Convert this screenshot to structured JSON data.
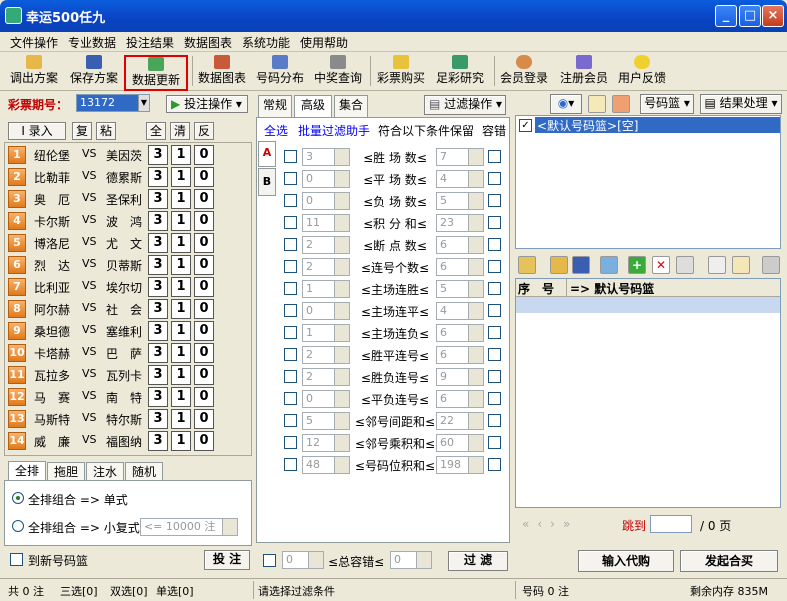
{
  "app": {
    "title": "幸运500任九"
  },
  "menu": [
    "文件操作",
    "专业数据",
    "投注结果",
    "数据图表",
    "系统功能",
    "使用帮助"
  ],
  "toolbar": [
    "调出方案",
    "保存方案",
    "数据更新",
    "数据图表",
    "号码分布",
    "中奖查询",
    "彩票购买",
    "足彩研究",
    "会员登录",
    "注册会员",
    "用户反馈"
  ],
  "period": {
    "label": "彩票期号：",
    "value": "13172"
  },
  "bet_op": "投注操作",
  "left_buttons": {
    "enter": "I 录入",
    "copy": "复",
    "paste": "粘",
    "all": "全",
    "clear": "清",
    "invert": "反"
  },
  "matches": [
    {
      "no": "1",
      "home": "纽伦堡",
      "vs": "VS",
      "away": "美因茨",
      "a": "3",
      "b": "1",
      "c": "0"
    },
    {
      "no": "2",
      "home": "比勒菲",
      "vs": "VS",
      "away": "德累斯",
      "a": "3",
      "b": "1",
      "c": "0"
    },
    {
      "no": "3",
      "home": "奥　厄",
      "vs": "VS",
      "away": "圣保利",
      "a": "3",
      "b": "1",
      "c": "0"
    },
    {
      "no": "4",
      "home": "卡尔斯",
      "vs": "VS",
      "away": "波　鸿",
      "a": "3",
      "b": "1",
      "c": "0"
    },
    {
      "no": "5",
      "home": "博洛尼",
      "vs": "VS",
      "away": "尤　文",
      "a": "3",
      "b": "1",
      "c": "0"
    },
    {
      "no": "6",
      "home": "烈　达",
      "vs": "VS",
      "away": "贝蒂斯",
      "a": "3",
      "b": "1",
      "c": "0"
    },
    {
      "no": "7",
      "home": "比利亚",
      "vs": "VS",
      "away": "埃尔切",
      "a": "3",
      "b": "1",
      "c": "0"
    },
    {
      "no": "8",
      "home": "阿尔赫",
      "vs": "VS",
      "away": "社　会",
      "a": "3",
      "b": "1",
      "c": "0"
    },
    {
      "no": "9",
      "home": "桑坦德",
      "vs": "VS",
      "away": "塞维利",
      "a": "3",
      "b": "1",
      "c": "0"
    },
    {
      "no": "10",
      "home": "卡塔赫",
      "vs": "VS",
      "away": "巴　萨",
      "a": "3",
      "b": "1",
      "c": "0"
    },
    {
      "no": "11",
      "home": "瓦拉多",
      "vs": "VS",
      "away": "瓦列卡",
      "a": "3",
      "b": "1",
      "c": "0"
    },
    {
      "no": "12",
      "home": "马　赛",
      "vs": "VS",
      "away": "南　特",
      "a": "3",
      "b": "1",
      "c": "0"
    },
    {
      "no": "13",
      "home": "马斯特",
      "vs": "VS",
      "away": "特尔斯",
      "a": "3",
      "b": "1",
      "c": "0"
    },
    {
      "no": "14",
      "home": "威　廉",
      "vs": "VS",
      "away": "福图纳",
      "a": "3",
      "b": "1",
      "c": "0"
    }
  ],
  "left_tabs": [
    "全排",
    "拖胆",
    "注水",
    "随机"
  ],
  "radio1": "全排组合 => 单式",
  "radio2": "全排组合 => 小复式",
  "combo_limit": "<= 10000 注",
  "to_new_basket": "到新号码篮",
  "bet_button": "投 注",
  "mid_tabs": [
    "常规",
    "高级",
    "集合"
  ],
  "filter_op": "过滤操作",
  "filter_bar": {
    "select_all": "全选",
    "batch": "批量过滤助手",
    "keep": "符合以下条件保留",
    "tolerance": "容错"
  },
  "side_tabs": [
    "A",
    "B"
  ],
  "filters": [
    {
      "min": "3",
      "label": "胜 场 数",
      "max": "7"
    },
    {
      "min": "0",
      "label": "平 场 数",
      "max": "4"
    },
    {
      "min": "0",
      "label": "负 场 数",
      "max": "5"
    },
    {
      "min": "11",
      "label": "积 分 和",
      "max": "23"
    },
    {
      "min": "2",
      "label": "断 点 数",
      "max": "6"
    },
    {
      "min": "2",
      "label": "连号个数",
      "max": "6"
    },
    {
      "min": "1",
      "label": "主场连胜",
      "max": "5"
    },
    {
      "min": "0",
      "label": "主场连平",
      "max": "4"
    },
    {
      "min": "1",
      "label": "主场连负",
      "max": "6"
    },
    {
      "min": "2",
      "label": "胜平连号",
      "max": "6"
    },
    {
      "min": "2",
      "label": "胜负连号",
      "max": "9"
    },
    {
      "min": "0",
      "label": "平负连号",
      "max": "6"
    },
    {
      "min": "5",
      "label": "邻号间距和",
      "max": "22"
    },
    {
      "min": "12",
      "label": "邻号乘积和",
      "max": "60"
    },
    {
      "min": "48",
      "label": "号码位积和",
      "max": "198"
    }
  ],
  "bottom_filter": {
    "min": "0",
    "label": "总容错",
    "max": "0",
    "button": "过 滤"
  },
  "right_top": {
    "basket": "号码篮",
    "result": "结果处理",
    "list_item": "<默认号码篮>[空]"
  },
  "grid": {
    "col1": "序　号",
    "col2": "=> 默认号码篮"
  },
  "pager": {
    "jump": "跳到",
    "pages": "/ 0 页"
  },
  "right_buttons": {
    "export": "输入代购",
    "buy": "发起合买"
  },
  "status": {
    "total": "共 0 注",
    "s3": "三选[0]",
    "s2": "双选[0]",
    "s1": "单选[0]",
    "hint": "请选择过滤条件",
    "codes": "号码 0 注",
    "mem": "剩余内存  835M"
  },
  "colors": {
    "titlebar": "#0a5ddd",
    "highlight": "#e00000",
    "selection": "#316ac5",
    "number": "#f0902a"
  }
}
